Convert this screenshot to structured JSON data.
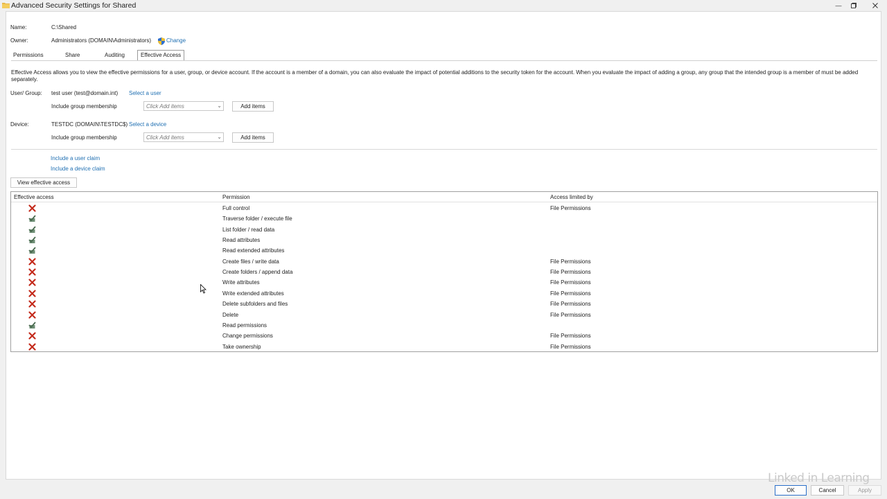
{
  "window": {
    "title": "Advanced Security Settings for Shared"
  },
  "name": {
    "label": "Name:",
    "value": "C:\\Shared"
  },
  "owner": {
    "label": "Owner:",
    "value": "Administrators (DOMAIN\\Administrators)",
    "change_link": "Change"
  },
  "tabs": [
    {
      "label": "Permissions",
      "active": false
    },
    {
      "label": "Share",
      "active": false
    },
    {
      "label": "Auditing",
      "active": false
    },
    {
      "label": "Effective Access",
      "active": true
    }
  ],
  "description": "Effective Access allows you to view the effective permissions for a user, group, or device account. If the account is a member of a domain, you can also evaluate the impact of potential additions to the security token for the account. When you evaluate the impact of adding a group, any group that the intended group is a member of must be added separately.",
  "user_group": {
    "label": "User/ Group:",
    "value": "test user (test@domain.int)",
    "select_link": "Select a user",
    "membership_label": "Include group membership",
    "combo_placeholder": "Click Add items",
    "add_button": "Add items"
  },
  "device": {
    "label": "Device:",
    "value": "TESTDC (DOMAIN\\TESTDC$)",
    "select_link": "Select a device",
    "membership_label": "Include group membership",
    "combo_placeholder": "Click Add items",
    "add_button": "Add items"
  },
  "claims": {
    "user_claim_link": "Include a user claim",
    "device_claim_link": "Include a device claim"
  },
  "view_button": "View effective access",
  "grid": {
    "headers": [
      "Effective access",
      "Permission",
      "Access limited by"
    ],
    "rows": [
      {
        "access": "denied",
        "permission": "Full control",
        "limited_by": "File Permissions"
      },
      {
        "access": "allowed",
        "permission": "Traverse folder / execute file",
        "limited_by": ""
      },
      {
        "access": "allowed",
        "permission": "List folder / read data",
        "limited_by": ""
      },
      {
        "access": "allowed",
        "permission": "Read attributes",
        "limited_by": ""
      },
      {
        "access": "allowed",
        "permission": "Read extended attributes",
        "limited_by": ""
      },
      {
        "access": "denied",
        "permission": "Create files / write data",
        "limited_by": "File Permissions"
      },
      {
        "access": "denied",
        "permission": "Create folders / append data",
        "limited_by": "File Permissions"
      },
      {
        "access": "denied",
        "permission": "Write attributes",
        "limited_by": "File Permissions"
      },
      {
        "access": "denied",
        "permission": "Write extended attributes",
        "limited_by": "File Permissions"
      },
      {
        "access": "denied",
        "permission": "Delete subfolders and files",
        "limited_by": "File Permissions"
      },
      {
        "access": "denied",
        "permission": "Delete",
        "limited_by": "File Permissions"
      },
      {
        "access": "allowed",
        "permission": "Read permissions",
        "limited_by": ""
      },
      {
        "access": "denied",
        "permission": "Change permissions",
        "limited_by": "File Permissions"
      },
      {
        "access": "denied",
        "permission": "Take ownership",
        "limited_by": "File Permissions"
      }
    ]
  },
  "footer": {
    "ok": "OK",
    "cancel": "Cancel",
    "apply": "Apply"
  },
  "watermark": "Linked in Learning",
  "colors": {
    "deny": "#c42b1c",
    "allow": "#4a6b50",
    "link": "#1f6fb2"
  }
}
